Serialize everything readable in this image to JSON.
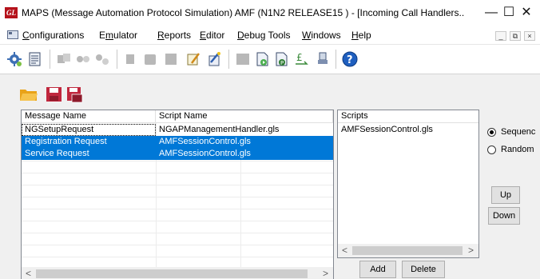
{
  "window": {
    "logo_text": "GL",
    "title": "MAPS (Message Automation Protocol Simulation) AMF (N1N2 RELEASE15 ) - [Incoming Call Handlers..",
    "minimize": "—",
    "maximize": "☐",
    "close": "✕"
  },
  "menu": {
    "items": [
      {
        "accel": "C",
        "rest": "onfigurations"
      },
      {
        "pre": "E",
        "accel": "m",
        "rest": "ulator"
      },
      {
        "accel": "R",
        "rest": "eports"
      },
      {
        "pre": "",
        "accel": "E",
        "rest": "ditor"
      },
      {
        "accel": "D",
        "rest": "ebug Tools"
      },
      {
        "accel": "W",
        "rest": "indows"
      },
      {
        "accel": "H",
        "rest": "elp"
      }
    ],
    "mdi_minimize": "_",
    "mdi_restore": "⧉",
    "mdi_close": "×"
  },
  "message_table": {
    "columns": [
      "Message Name",
      "Script Name"
    ],
    "rows": [
      {
        "message": "NGSetupRequest",
        "script": "NGAPManagementHandler.gls",
        "selected": false
      },
      {
        "message": "Registration Request",
        "script": "AMFSessionControl.gls",
        "selected": true
      },
      {
        "message": "Service Request",
        "script": "AMFSessionControl.gls",
        "selected": true
      }
    ],
    "scroll_left": "<",
    "scroll_right": ">"
  },
  "scripts": {
    "header": "Scripts",
    "items": [
      "AMFSessionControl.gls"
    ],
    "scroll_left": "<",
    "scroll_right": ">"
  },
  "buttons": {
    "add": "Add",
    "delete": "Delete",
    "up": "Up",
    "down": "Down"
  },
  "order": {
    "options": [
      {
        "label": "Sequenc",
        "checked": true
      },
      {
        "label": "Random",
        "checked": false
      }
    ]
  },
  "colors": {
    "selection": "#0078d7",
    "logo": "#b5121b",
    "save_icon": "#c0273d",
    "open_icon": "#f0b429"
  }
}
